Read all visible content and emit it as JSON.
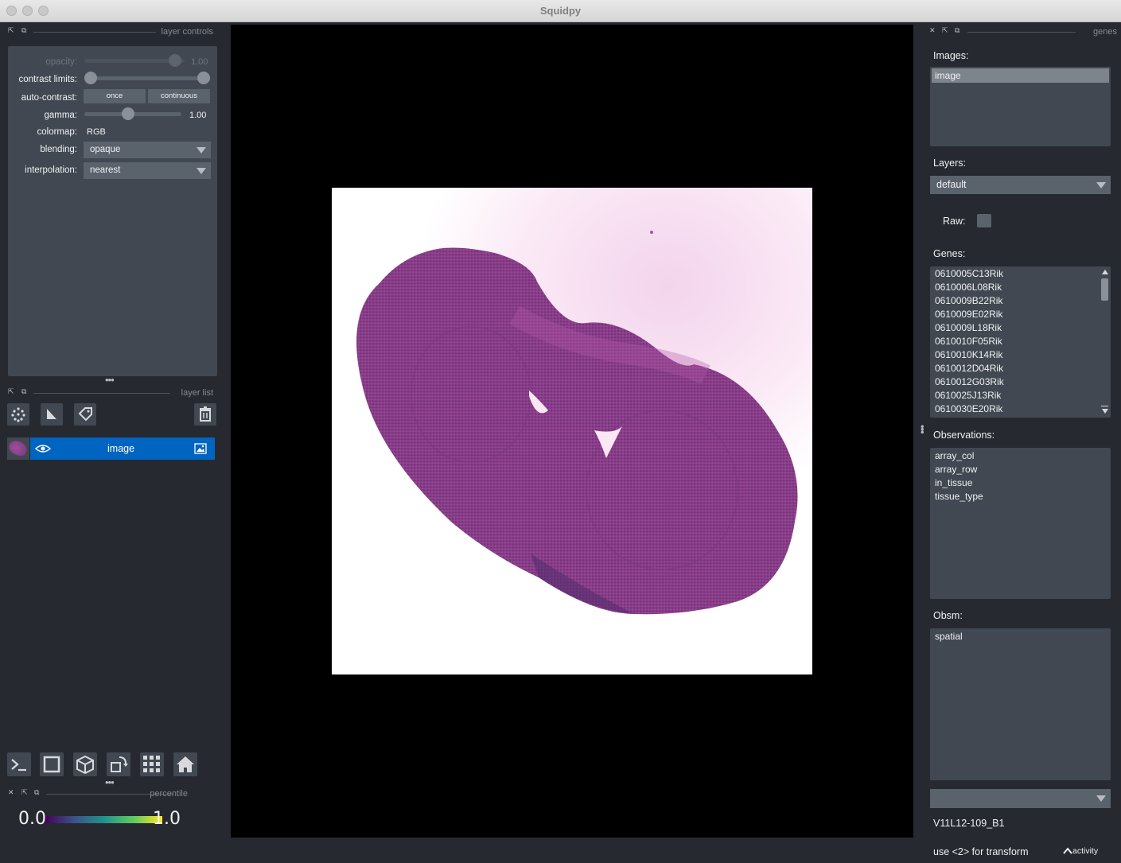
{
  "window": {
    "title": "Squidpy"
  },
  "left_dock": {
    "layer_controls": {
      "title": "layer controls",
      "opacity_label": "opacity:",
      "opacity_value": "1.00",
      "opacity": 1.0,
      "contrast_label": "contrast limits:",
      "contrast_limits": [
        0.0,
        1.0
      ],
      "autocontrast_label": "auto-contrast:",
      "once_label": "once",
      "continuous_label": "continuous",
      "gamma_label": "gamma:",
      "gamma_value": "1.00",
      "colormap_label": "colormap:",
      "colormap_value": "RGB",
      "blending_label": "blending:",
      "blending_value": "opaque",
      "interpolation_label": "interpolation:",
      "interpolation_value": "nearest"
    },
    "layer_list": {
      "title": "layer list",
      "layers": [
        {
          "name": "image",
          "visible": true,
          "selected": true
        }
      ]
    },
    "percentile": {
      "title": "percentile",
      "min_label": "0.0",
      "max_label": "1.0",
      "colors": [
        "#440154",
        "#3b528b",
        "#21918c",
        "#5ec962",
        "#fde725"
      ]
    }
  },
  "right_dock": {
    "title": "genes",
    "images_label": "Images:",
    "images": [
      "image"
    ],
    "layers_label": "Layers:",
    "layers_value": "default",
    "raw_label": "Raw:",
    "raw_checked": false,
    "genes_label": "Genes:",
    "genes": [
      "0610005C13Rik",
      "0610006L08Rik",
      "0610009B22Rik",
      "0610009E02Rik",
      "0610009L18Rik",
      "0610010F05Rik",
      "0610010K14Rik",
      "0610012D04Rik",
      "0610012G03Rik",
      "0610025J13Rik",
      "0610030E20Rik"
    ],
    "observations_label": "Observations:",
    "observations": [
      "array_col",
      "array_row",
      "in_tissue",
      "tissue_type"
    ],
    "obsm_label": "Obsm:",
    "obsm": [
      "spatial"
    ],
    "library_value": "",
    "library_id": "V11L12-109_B1"
  },
  "status": {
    "hint": "use <2> for transform",
    "activity_label": "activity"
  },
  "colors": {
    "background": "#262930",
    "panel": "#414851",
    "control": "#5a626c",
    "selection": "#0065c0",
    "text": "#f0f1f2"
  }
}
